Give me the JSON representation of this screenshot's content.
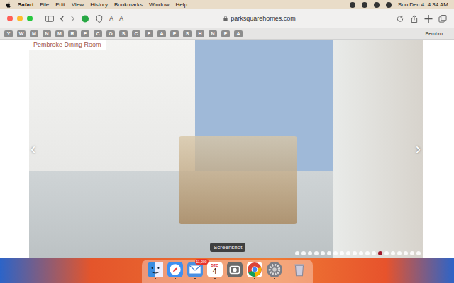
{
  "menu_bar": {
    "app": "Safari",
    "items": [
      "File",
      "Edit",
      "View",
      "History",
      "Bookmarks",
      "Window",
      "Help"
    ],
    "clock": "Sun Dec 4  4:34 AM"
  },
  "toolbar": {
    "url": "parksquarehomes.com",
    "reader_labels": [
      "A",
      "A"
    ]
  },
  "favorites": [
    {
      "label": "Y"
    },
    {
      "label": "W"
    },
    {
      "label": "M"
    },
    {
      "label": "N"
    },
    {
      "label": "M"
    },
    {
      "label": "R"
    },
    {
      "label": "F"
    },
    {
      "label": "C"
    },
    {
      "label": "O"
    },
    {
      "label": "S"
    },
    {
      "label": "C"
    },
    {
      "label": "F"
    },
    {
      "label": "A"
    },
    {
      "label": "F"
    },
    {
      "label": "S"
    },
    {
      "label": "H"
    },
    {
      "label": "N"
    },
    {
      "label": "F"
    },
    {
      "label": "A"
    },
    {
      "label": "Pembro…"
    }
  ],
  "gallery": {
    "caption": "Pembroke Dining Room",
    "prev": "‹",
    "next": "›",
    "dots": [
      {
        "selected": false
      },
      {
        "selected": false
      },
      {
        "selected": false
      },
      {
        "selected": false
      },
      {
        "selected": false
      },
      {
        "selected": false
      },
      {
        "selected": false
      },
      {
        "selected": false
      },
      {
        "selected": false
      },
      {
        "selected": false
      },
      {
        "selected": false
      },
      {
        "selected": false
      },
      {
        "selected": false
      },
      {
        "selected": true
      },
      {
        "selected": false
      },
      {
        "selected": false
      },
      {
        "selected": false
      },
      {
        "selected": false
      },
      {
        "selected": false
      },
      {
        "selected": false
      }
    ]
  },
  "tooltip": "Screenshot",
  "dock": [
    {
      "kind": "finder",
      "running": true
    },
    {
      "kind": "safari",
      "running": true
    },
    {
      "kind": "mail",
      "running": true,
      "badge": "11,000"
    },
    {
      "kind": "calendar",
      "running": true,
      "month": "DEC",
      "day": "4"
    },
    {
      "kind": "screenshot",
      "running": false
    },
    {
      "kind": "chrome",
      "running": true
    },
    {
      "kind": "settings",
      "running": true
    },
    {
      "kind": "trash",
      "running": false
    }
  ]
}
